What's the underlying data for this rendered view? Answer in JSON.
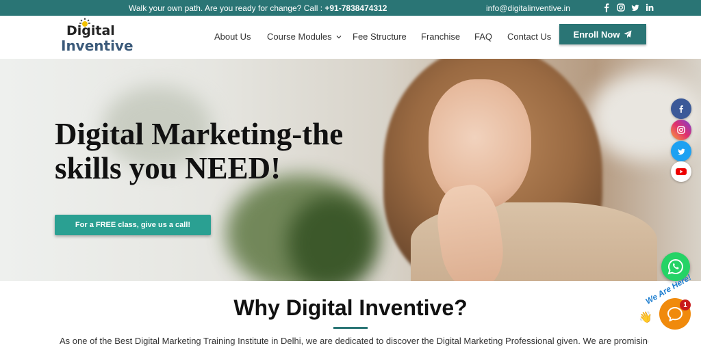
{
  "topbar": {
    "tagline_prefix": "Walk your own path. Are you ready for change? Call : ",
    "phone": "+91-7838474312",
    "email": "info@digitalinventive.in",
    "socials": [
      "facebook-icon",
      "instagram-icon",
      "twitter-icon",
      "linkedin-icon"
    ]
  },
  "logo": {
    "line1": "Digital",
    "line2": "Inventive"
  },
  "nav": {
    "items": [
      {
        "label": "About Us"
      },
      {
        "label": "Course Modules"
      },
      {
        "label": "Fee Structure"
      },
      {
        "label": "Franchise"
      },
      {
        "label": "FAQ"
      },
      {
        "label": "Contact Us"
      }
    ],
    "enroll_label": "Enroll Now"
  },
  "hero": {
    "headline": "Digital Marketing-the skills you NEED!",
    "cta_label": "For a FREE class, give us a call!"
  },
  "floating_socials": [
    "facebook-icon",
    "instagram-icon",
    "twitter-icon",
    "youtube-icon"
  ],
  "section": {
    "title": "Why Digital Inventive?",
    "body": "As one of the Best Digital Marketing Training Institute in Delhi, we are dedicated to discover the Digital Marketing Professional given. We are promising"
  },
  "chat": {
    "banner": "We Are Here!",
    "unread": "1"
  },
  "colors": {
    "primary": "#2a7575",
    "cta": "#2aa092",
    "whatsapp": "#25d366",
    "chat": "#f08a0c"
  }
}
